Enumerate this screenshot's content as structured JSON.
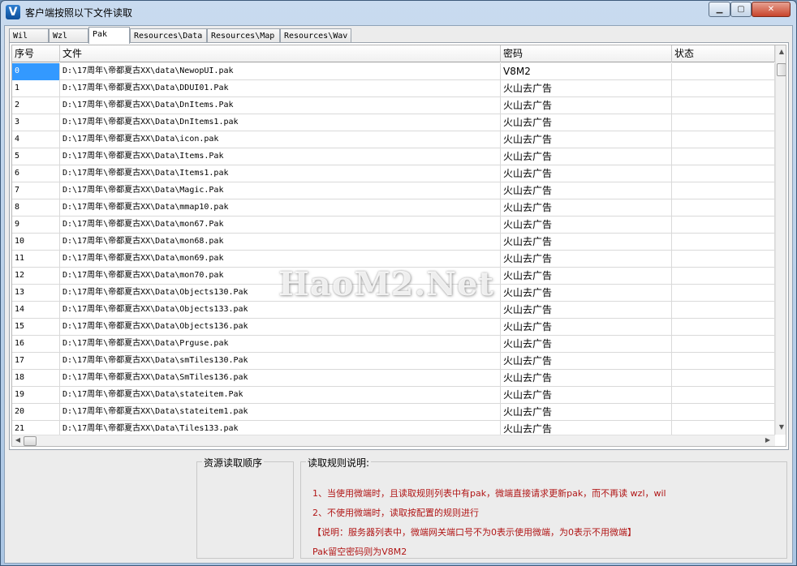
{
  "window": {
    "title": "客户端按照以下文件读取",
    "app_icon": "V"
  },
  "tabs": [
    {
      "label": "Wil",
      "active": false
    },
    {
      "label": "Wzl",
      "active": false
    },
    {
      "label": "Pak",
      "active": true
    },
    {
      "label": "Resources\\Data",
      "active": false
    },
    {
      "label": "Resources\\Map",
      "active": false
    },
    {
      "label": "Resources\\Wav",
      "active": false
    }
  ],
  "grid": {
    "columns": [
      "序号",
      "文件",
      "密码",
      "状态"
    ],
    "selected_index": 0,
    "rows": [
      [
        "0",
        "D:\\17周年\\帝都夏古XX\\data\\NewopUI.pak",
        "V8M2",
        ""
      ],
      [
        "1",
        "D:\\17周年\\帝都夏古XX\\Data\\DDUI01.Pak",
        "火山去广告",
        ""
      ],
      [
        "2",
        "D:\\17周年\\帝都夏古XX\\Data\\DnItems.Pak",
        "火山去广告",
        ""
      ],
      [
        "3",
        "D:\\17周年\\帝都夏古XX\\Data\\DnItems1.pak",
        "火山去广告",
        ""
      ],
      [
        "4",
        "D:\\17周年\\帝都夏古XX\\Data\\icon.pak",
        "火山去广告",
        ""
      ],
      [
        "5",
        "D:\\17周年\\帝都夏古XX\\Data\\Items.Pak",
        "火山去广告",
        ""
      ],
      [
        "6",
        "D:\\17周年\\帝都夏古XX\\Data\\Items1.pak",
        "火山去广告",
        ""
      ],
      [
        "7",
        "D:\\17周年\\帝都夏古XX\\Data\\Magic.Pak",
        "火山去广告",
        ""
      ],
      [
        "8",
        "D:\\17周年\\帝都夏古XX\\Data\\mmap10.pak",
        "火山去广告",
        ""
      ],
      [
        "9",
        "D:\\17周年\\帝都夏古XX\\Data\\mon67.Pak",
        "火山去广告",
        ""
      ],
      [
        "10",
        "D:\\17周年\\帝都夏古XX\\Data\\mon68.pak",
        "火山去广告",
        ""
      ],
      [
        "11",
        "D:\\17周年\\帝都夏古XX\\Data\\mon69.pak",
        "火山去广告",
        ""
      ],
      [
        "12",
        "D:\\17周年\\帝都夏古XX\\Data\\mon70.pak",
        "火山去广告",
        ""
      ],
      [
        "13",
        "D:\\17周年\\帝都夏古XX\\Data\\Objects130.Pak",
        "火山去广告",
        ""
      ],
      [
        "14",
        "D:\\17周年\\帝都夏古XX\\Data\\Objects133.pak",
        "火山去广告",
        ""
      ],
      [
        "15",
        "D:\\17周年\\帝都夏古XX\\Data\\Objects136.pak",
        "火山去广告",
        ""
      ],
      [
        "16",
        "D:\\17周年\\帝都夏古XX\\Data\\Prguse.pak",
        "火山去广告",
        ""
      ],
      [
        "17",
        "D:\\17周年\\帝都夏古XX\\Data\\smTiles130.Pak",
        "火山去广告",
        ""
      ],
      [
        "18",
        "D:\\17周年\\帝都夏古XX\\Data\\SmTiles136.pak",
        "火山去广告",
        ""
      ],
      [
        "19",
        "D:\\17周年\\帝都夏古XX\\Data\\stateitem.Pak",
        "火山去广告",
        ""
      ],
      [
        "20",
        "D:\\17周年\\帝都夏古XX\\Data\\stateitem1.pak",
        "火山去广告",
        ""
      ],
      [
        "21",
        "D:\\17周年\\帝都夏古XX\\Data\\Tiles133.pak",
        "火山去广告",
        ""
      ]
    ]
  },
  "watermark": "HaoM2.Net",
  "resource_order": {
    "title": "资源读取顺序"
  },
  "rules": {
    "title": "读取规则说明:",
    "lines": [
      "1、当使用微端时，且读取规则列表中有pak，微端直接请求更新pak，而不再读 wzl，wil",
      "2、不使用微端时，读取按配置的规则进行",
      "【说明：服务器列表中，微端网关端口号不为0表示使用微端，为0表示不用微端】",
      "Pak留空密码则为V8M2"
    ],
    "color": "#b11616"
  }
}
